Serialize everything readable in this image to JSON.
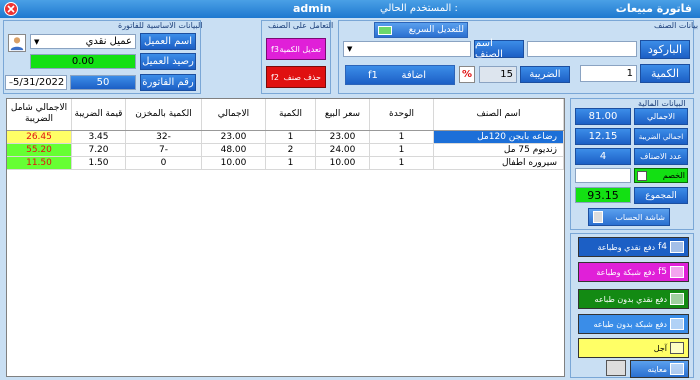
{
  "window": {
    "title": "فاتورة مبيعات",
    "current_user_label": "المستخدم الحالي :",
    "current_user": "admin"
  },
  "basic_info": {
    "title": "البيانات الاساسية للفاتورة",
    "customer_label": "اسم العميل",
    "customer_value": "عميل نقدي",
    "balance_label": "رصيد العميل",
    "balance_value": "0.00",
    "invoice_no_label": "رقم الفاتورة",
    "invoice_no_value": "50",
    "date_value": "5/31/2022"
  },
  "item_ops": {
    "title": "التعامل على الصنف",
    "edit_qty_label": "تعديل الكمية",
    "edit_qty_key": "f3",
    "delete_label": "حذف صنف",
    "delete_key": "f2"
  },
  "item_data": {
    "title": "بيانات الصنف",
    "quick_edit_label": "للتعديل السريع",
    "barcode_label": "الباركود",
    "item_name_label": "اسم الصنف",
    "qty_label": "الكمية",
    "qty_value": "1",
    "tax_label": "الضريبة",
    "tax_value": "15",
    "percent_symbol": "%",
    "add_label": "اضافة",
    "add_key": "f1"
  },
  "table": {
    "columns": [
      "اسم الصنف",
      "الوحدة",
      "سعر البيع",
      "الكمية",
      "الاجمالي",
      "الكمية بالمخزن",
      "قيمة الضريبة",
      "الاجمالي شامل الضريبة"
    ],
    "rows": [
      [
        "رضاعه بايجن 120مل",
        "1",
        "23.00",
        "1",
        "23.00",
        "-32",
        "3.45",
        "26.45"
      ],
      [
        "زنديوم 75 مل",
        "1",
        "24.00",
        "2",
        "48.00",
        "-7",
        "7.20",
        "55.20"
      ],
      [
        "سيروره اطفال",
        "1",
        "10.00",
        "1",
        "10.00",
        "0",
        "1.50",
        "11.50"
      ]
    ]
  },
  "stats": {
    "title": "البيانات المالية",
    "total_label": "الاجمالي",
    "total_value": "81.00",
    "tax_total_label": "اجمالي الضريبة",
    "tax_total_value": "12.15",
    "count_label": "عدد الاصناف",
    "count_value": "4",
    "discount_label": "الخصم",
    "discount_value": "",
    "sum_label": "المجموع",
    "sum_value": "93.15",
    "calc_label": "شاشة الحساب"
  },
  "actions": {
    "cash_print": "دفع نقدي وطباعة",
    "cash_print_key": "f4",
    "card_print": "دفع شبكة وطباعة",
    "card_print_key": "f5",
    "cash_noprint": "دفع نقدي بدون طباعه",
    "card_noprint": "دفع شبكة بدون طباعه",
    "defer": "آجل",
    "preview": "معاينه"
  },
  "colors": {
    "accent": "#1c5fc5",
    "green": "#13e013",
    "pink": "#e020d8",
    "red": "#e01010",
    "yellow": "#ffff66",
    "grid_red": "#ff3333",
    "grid_green": "#66ff33"
  }
}
